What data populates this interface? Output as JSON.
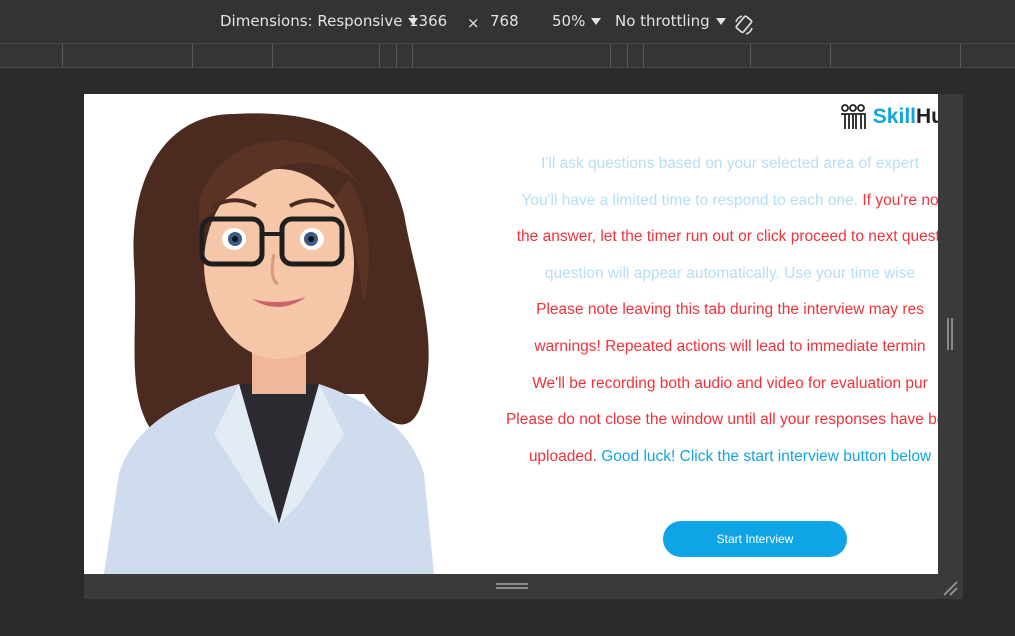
{
  "toolbar": {
    "dimensions_label": "Dimensions: Responsive",
    "width_value": "1366",
    "times": "×",
    "height_value": "768",
    "zoom": "50%",
    "throttling": "No throttling"
  },
  "page": {
    "logo": {
      "prefix": "Skill",
      "suffix": "Hu",
      "icon": "people-icon"
    },
    "lines": [
      {
        "segments": [
          {
            "text": "I'll ask questions based on your selected area of expert",
            "style": "faded"
          }
        ]
      },
      {
        "segments": [
          {
            "text": "You'll have a limited time to respond to each one. ",
            "style": "faded"
          },
          {
            "text": "If you're no",
            "style": "red"
          }
        ]
      },
      {
        "segments": [
          {
            "text": "the answer, let the timer run out or click proceed to next questi",
            "style": "red"
          }
        ]
      },
      {
        "segments": [
          {
            "text": "question will appear automatically. Use your time wise",
            "style": "faded"
          }
        ]
      },
      {
        "segments": [
          {
            "text": "Please note leaving this tab during the interview may res",
            "style": "red"
          }
        ]
      },
      {
        "segments": [
          {
            "text": "warnings! Repeated actions will lead to immediate termin",
            "style": "red"
          }
        ]
      },
      {
        "segments": [
          {
            "text": "We'll be recording both audio and video for evaluation pur",
            "style": "red"
          }
        ]
      },
      {
        "segments": [
          {
            "text": "Please do not close the window until all your responses have bee",
            "style": "red"
          }
        ]
      },
      {
        "segments": [
          {
            "text": "uploaded. ",
            "style": "red"
          },
          {
            "text": "Good luck! Click the start interview button below",
            "style": "blue"
          }
        ]
      }
    ],
    "start_button": "Start Interview"
  },
  "colors": {
    "accent": "#0fa4e6",
    "warning": "#f1323a",
    "faded": "#b4dff5",
    "devtools_bg": "#2b2b2b"
  }
}
